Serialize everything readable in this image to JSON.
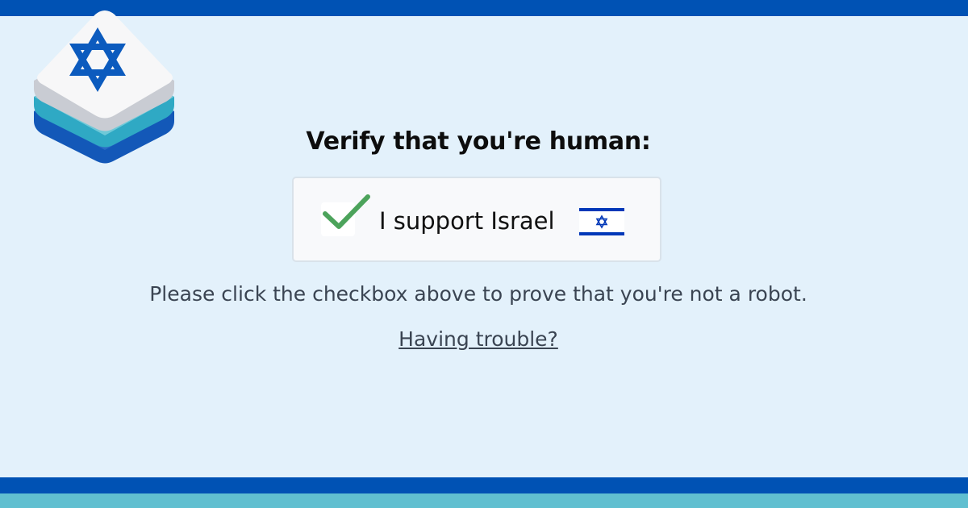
{
  "heading": "Verify that you're human:",
  "captcha": {
    "label": "I support Israel",
    "checked": true,
    "check_icon": "checkmark-icon",
    "flag_icon": "israel-flag-icon"
  },
  "instruction": "Please click the checkbox above to prove that you're not a robot.",
  "help_link": "Having trouble?",
  "logo_icon": "star-of-david-logo-icon",
  "colors": {
    "background": "#e3f1fb",
    "brand_blue": "#0052b4",
    "accent_teal": "#60bfd0",
    "check_green": "#4ca35b"
  }
}
